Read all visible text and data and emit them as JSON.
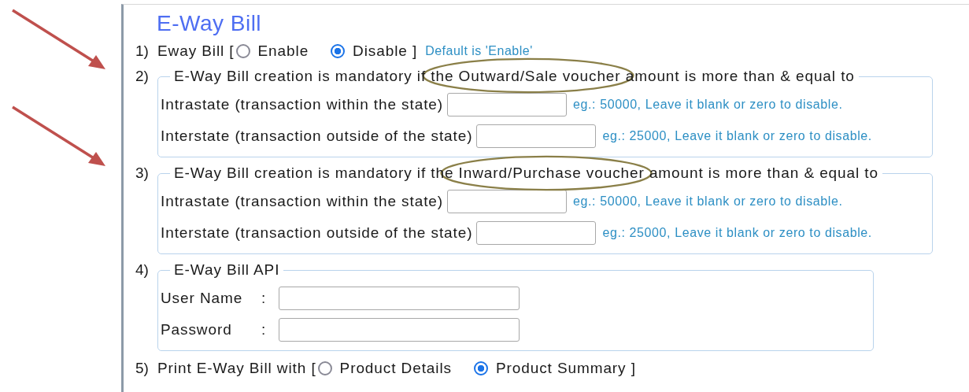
{
  "title": "E-Way Bill",
  "items": [
    {
      "kind": "radio",
      "number": "1)",
      "label": "Eway Bill [",
      "options": [
        {
          "label": "Enable",
          "selected": false
        },
        {
          "label": "Disable ]",
          "selected": true
        }
      ],
      "note": "Default is 'Enable'"
    },
    {
      "kind": "group",
      "number": "2)",
      "annotated": true,
      "legend": "E-Way Bill creation is mandatory if the Outward/Sale voucher amount is more than & equal to",
      "fields": [
        {
          "label": "Intrastate (transaction within the state)",
          "hint": "eg.: 50000, Leave it blank or zero to disable."
        },
        {
          "label": "Interstate (transaction outside of the state)",
          "hint": "eg.: 25000, Leave it blank or zero to disable."
        }
      ]
    },
    {
      "kind": "group",
      "number": "3)",
      "annotated": true,
      "legend": "E-Way Bill creation is mandatory if the Inward/Purchase voucher amount is more than & equal to",
      "fields": [
        {
          "label": "Intrastate (transaction within the state)",
          "hint": "eg.: 50000, Leave it blank or zero to disable."
        },
        {
          "label": "Interstate (transaction outside of the state)",
          "hint": "eg.: 25000, Leave it blank or zero to disable."
        }
      ]
    },
    {
      "kind": "group",
      "number": "4)",
      "legend": "E-Way Bill API",
      "fields": [
        {
          "label": "User Name",
          "separator": ":"
        },
        {
          "label": "Password",
          "separator": ":"
        }
      ]
    },
    {
      "kind": "radio",
      "number": "5)",
      "label": "Print E-Way Bill with [",
      "options": [
        {
          "label": "Product Details",
          "selected": false
        },
        {
          "label": "Product Summary ]",
          "selected": true
        }
      ]
    }
  ]
}
